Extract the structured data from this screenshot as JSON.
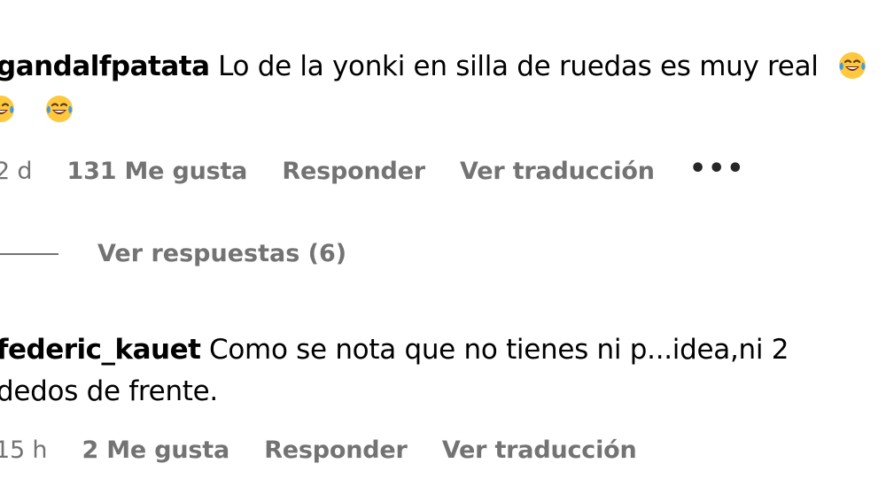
{
  "comments": [
    {
      "username": "gandalfpatata",
      "text": "Lo de la yonki en silla de ruedas es muy real",
      "emojis": [
        "tears-of-joy",
        "tears-of-joy",
        "tears-of-joy"
      ],
      "time": "2 d",
      "likes": "131 Me gusta",
      "reply_label": "Responder",
      "translate_label": "Ver traducción",
      "more_label": "•••"
    },
    {
      "username": "federic_kauet",
      "text_line1": "Como se nota que no tienes ni p...idea,ni 2",
      "text_line2": "dedos de frente.",
      "time": "15 h",
      "likes": "2 Me gusta",
      "reply_label": "Responder",
      "translate_label": "Ver traducción"
    }
  ],
  "view_replies": "Ver respuestas (6)",
  "colors": {
    "text": "#000000",
    "secondary": "#737373",
    "emoji_face": "#FFC83D",
    "emoji_tears": "#3E9BE9"
  }
}
